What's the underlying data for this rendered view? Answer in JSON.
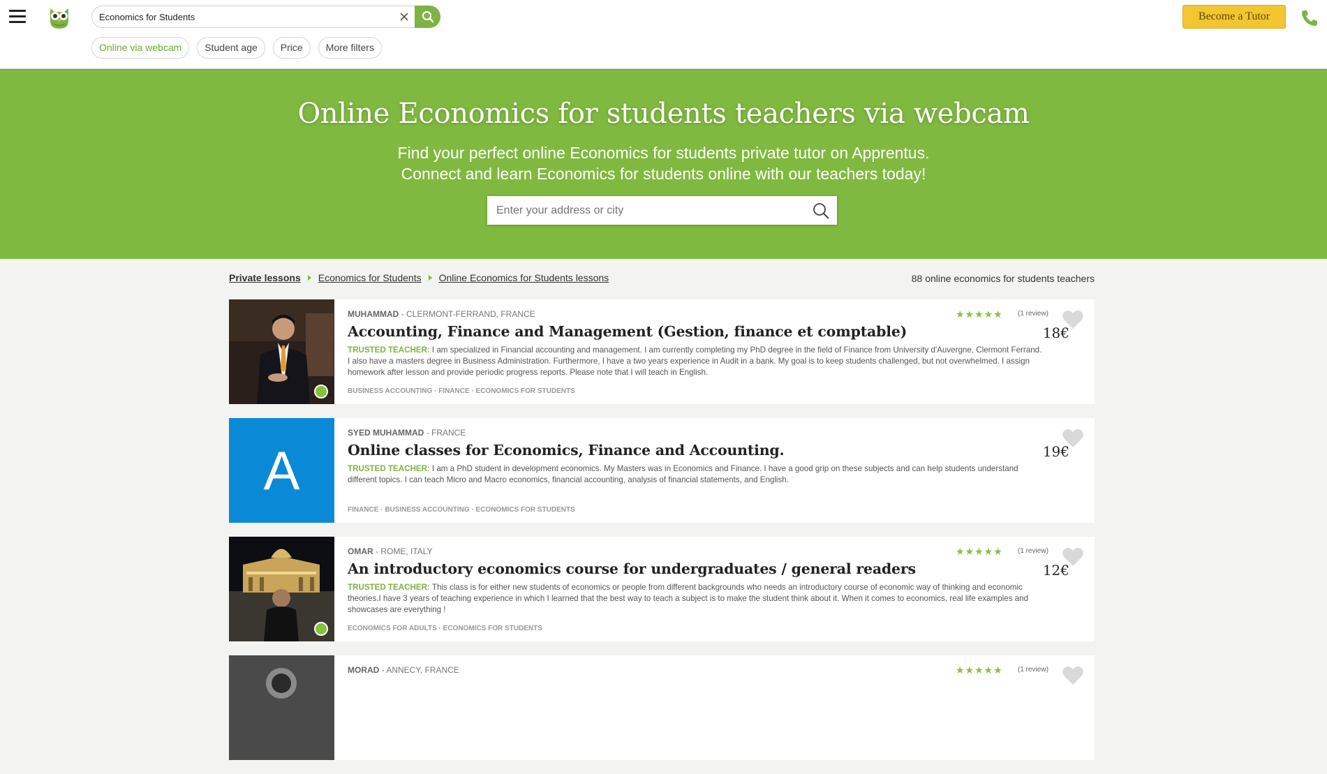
{
  "header": {
    "search_value": "Economics for Students",
    "filters": [
      "Online via webcam",
      "Student age",
      "Price",
      "More filters"
    ],
    "become_tutor_label": "Become a Tutor"
  },
  "hero": {
    "title": "Online Economics for students teachers via webcam",
    "subtitle_line1": "Find your perfect online Economics for students private tutor on Apprentus.",
    "subtitle_line2": "Connect and learn Economics for students online with our teachers today!",
    "address_placeholder": "Enter your address or city"
  },
  "breadcrumb": {
    "items": [
      "Private lessons",
      "Economics for Students",
      "Online Economics for Students lessons"
    ]
  },
  "results_count": "88 online economics for students teachers",
  "colors": {
    "brand_green": "#80b93f",
    "accent_yellow": "#f2c631",
    "avatar_blue": "#0a8ad6"
  },
  "listings": [
    {
      "name": "MUHAMMAD",
      "location": "- CLERMONT-FERRAND, FRANCE",
      "title": "Accounting, Finance and Management (Gestion, finance et comptable)",
      "trusted_label": "TRUSTED TEACHER:",
      "description": "I am specialized in Financial accounting and management. I am currently completing my PhD degree in the field of Finance from University d'Auvergne, Clermont Ferrand. I also have a masters degree in Business Administration. Furthermore, I have a two years experience in Audit in a bank. My goal is to keep students challenged, but not overwhelmed. I assign homework after lesson and provide periodic progress reports. Please note that I will teach in English.",
      "tags": "BUSINESS ACCOUNTING · FINANCE · ECONOMICS FOR STUDENTS",
      "stars": "★★★★★",
      "reviews": "(1 review)",
      "price": "18€",
      "photo": "photo-man-suit",
      "verified": true
    },
    {
      "name": "SYED MUHAMMAD",
      "location": "- FRANCE",
      "title": "Online classes for Economics, Finance and Accounting.",
      "trusted_label": "TRUSTED TEACHER:",
      "description": "I am a PhD student in development economics. My Masters was in Economics and Finance. I have a good grip on these subjects and can help students understand different topics. I can teach Micro and Macro economics, financial accounting, analysis of financial statements, and English.",
      "tags": "FINANCE · BUSINESS ACCOUNTING · ECONOMICS FOR STUDENTS",
      "stars": "",
      "reviews": "",
      "price": "19€",
      "avatar_letter": "A",
      "verified": false
    },
    {
      "name": "OMAR",
      "location": "- ROME, ITALY",
      "title": "An introductory economics course for undergraduates / general readers",
      "trusted_label": "TRUSTED TEACHER:",
      "description": "This class is for either new students of economics or people from different backgrounds who needs an introductory course of economic way of thinking and economic theories.I have 3 years of teaching experience in which I learned that the best way to teach a subject is to make the student think about it. When it comes to economics, real life examples and showcases are everything !",
      "tags": "ECONOMICS FOR ADULTS · ECONOMICS FOR STUDENTS",
      "stars": "★★★★★",
      "reviews": "(1 review)",
      "price": "12€",
      "photo": "photo-man-night-square",
      "verified": true
    },
    {
      "name": "MORAD",
      "location": "- ANNECY, FRANCE",
      "title": "",
      "trusted_label": "",
      "description": "",
      "tags": "",
      "stars": "★★★★★",
      "reviews": "(1 review)",
      "price": "",
      "photo": "photo-partial",
      "verified": false
    }
  ]
}
